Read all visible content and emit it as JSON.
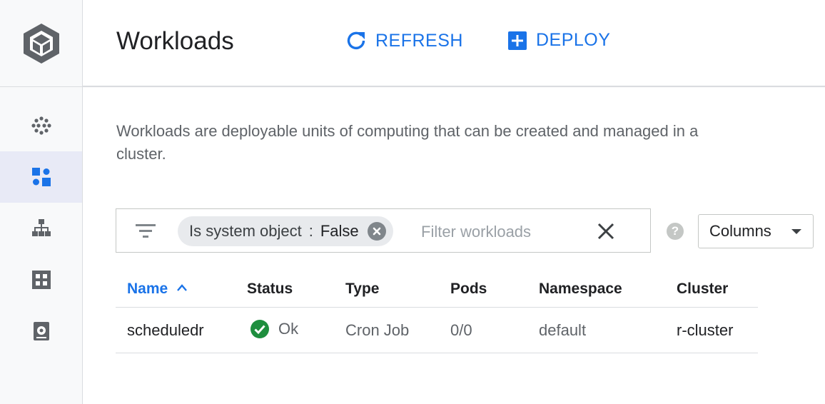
{
  "header": {
    "title": "Workloads",
    "refresh_label": "REFRESH",
    "deploy_label": "DEPLOY"
  },
  "rail": {
    "logo_icon": "kubernetes-engine-logo",
    "items": [
      {
        "icon": "clusters-icon",
        "active": false
      },
      {
        "icon": "workloads-icon",
        "active": true
      },
      {
        "icon": "services-icon",
        "active": false
      },
      {
        "icon": "applications-icon",
        "active": false
      },
      {
        "icon": "storage-icon",
        "active": false
      }
    ]
  },
  "description": "Workloads are deployable units of computing that can be created and managed in a cluster.",
  "filter": {
    "chip_key": "Is system object",
    "chip_separator": ":",
    "chip_value": "False",
    "placeholder": "Filter workloads"
  },
  "columns_label": "Columns",
  "help_label": "?",
  "table": {
    "headers": [
      "Name",
      "Status",
      "Type",
      "Pods",
      "Namespace",
      "Cluster"
    ],
    "sort_indicator": "^",
    "rows": [
      {
        "name": "scheduledr",
        "status": "Ok",
        "type": "Cron Job",
        "pods": "0/0",
        "namespace": "default",
        "cluster": "r-cluster"
      }
    ]
  },
  "colors": {
    "accent": "#1a73e8",
    "status_ok": "#1e8e3e",
    "rail_active": "#e8eaf6"
  }
}
